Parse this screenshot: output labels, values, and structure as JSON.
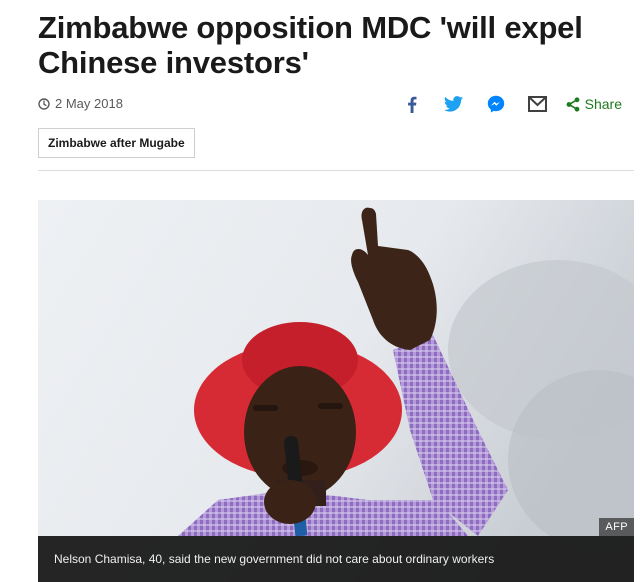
{
  "article": {
    "headline": "Zimbabwe opposition MDC 'will expel Chinese investors'",
    "date": "2 May 2018",
    "tag": "Zimbabwe after Mugabe"
  },
  "share": {
    "label": "Share",
    "icons": [
      "facebook-icon",
      "twitter-icon",
      "messenger-icon",
      "email-icon",
      "share-icon",
      "clock-icon"
    ],
    "colors": {
      "facebook": "#3b5998",
      "twitter": "#1da1f2",
      "messenger": "#0084ff",
      "email": "#404040",
      "share": "#1f7a1f"
    }
  },
  "image": {
    "credit": "AFP",
    "caption": "Nelson Chamisa, 40, said the new government did not care about ordinary workers"
  }
}
